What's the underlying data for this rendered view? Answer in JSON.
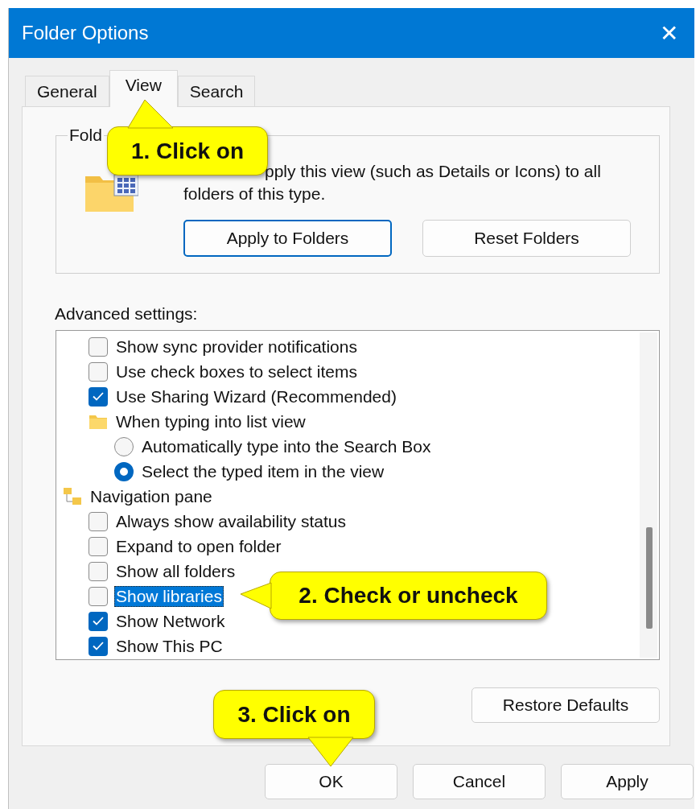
{
  "window": {
    "title": "Folder Options",
    "close": "✕"
  },
  "tabs": [
    {
      "label": "General",
      "selected": false
    },
    {
      "label": "View",
      "selected": true
    },
    {
      "label": "Search",
      "selected": false
    }
  ],
  "folder_views": {
    "legend": "Fold",
    "description_line_1": "pply this view (such as Details or Icons) to all",
    "description_line_2": "folders of this type.",
    "buttons": [
      {
        "label": "Apply to Folders",
        "default": true
      },
      {
        "label": "Reset Folders",
        "default": false
      }
    ]
  },
  "advanced_settings": {
    "label": "Advanced settings:",
    "tree": [
      {
        "kind": "continued",
        "children": [
          {
            "kind": "checkbox",
            "label": "Show sync provider notifications",
            "checked": false,
            "selected": false
          },
          {
            "kind": "checkbox",
            "label": "Use check boxes to select items",
            "checked": false,
            "selected": false
          },
          {
            "kind": "checkbox",
            "label": "Use Sharing Wizard (Recommended)",
            "checked": true,
            "selected": false
          },
          {
            "kind": "group",
            "label": "When typing into list view",
            "children": [
              {
                "kind": "radio",
                "label": "Automatically type into the Search Box",
                "checked": false,
                "selected": false
              },
              {
                "kind": "radio",
                "label": "Select the typed item in the view",
                "checked": true,
                "selected": false
              }
            ]
          }
        ]
      },
      {
        "kind": "group",
        "label": "Navigation pane",
        "children": [
          {
            "kind": "checkbox",
            "label": "Always show availability status",
            "checked": false,
            "selected": false
          },
          {
            "kind": "checkbox",
            "label": "Expand to open folder",
            "checked": false,
            "selected": false
          },
          {
            "kind": "checkbox",
            "label": "Show all folders",
            "checked": false,
            "selected": false
          },
          {
            "kind": "checkbox",
            "label": "Show libraries",
            "checked": false,
            "selected": true
          },
          {
            "kind": "checkbox",
            "label": "Show Network",
            "checked": true,
            "selected": false
          },
          {
            "kind": "checkbox",
            "label": "Show This PC",
            "checked": true,
            "selected": false
          }
        ]
      }
    ]
  },
  "restore_defaults": "Restore Defaults",
  "dialog_buttons": [
    "OK",
    "Cancel",
    "Apply"
  ],
  "callouts": [
    {
      "text": "1. Click on",
      "kind": "up"
    },
    {
      "text": "2. Check or uncheck",
      "kind": "left"
    },
    {
      "text": "3. Click on",
      "kind": "down"
    }
  ]
}
